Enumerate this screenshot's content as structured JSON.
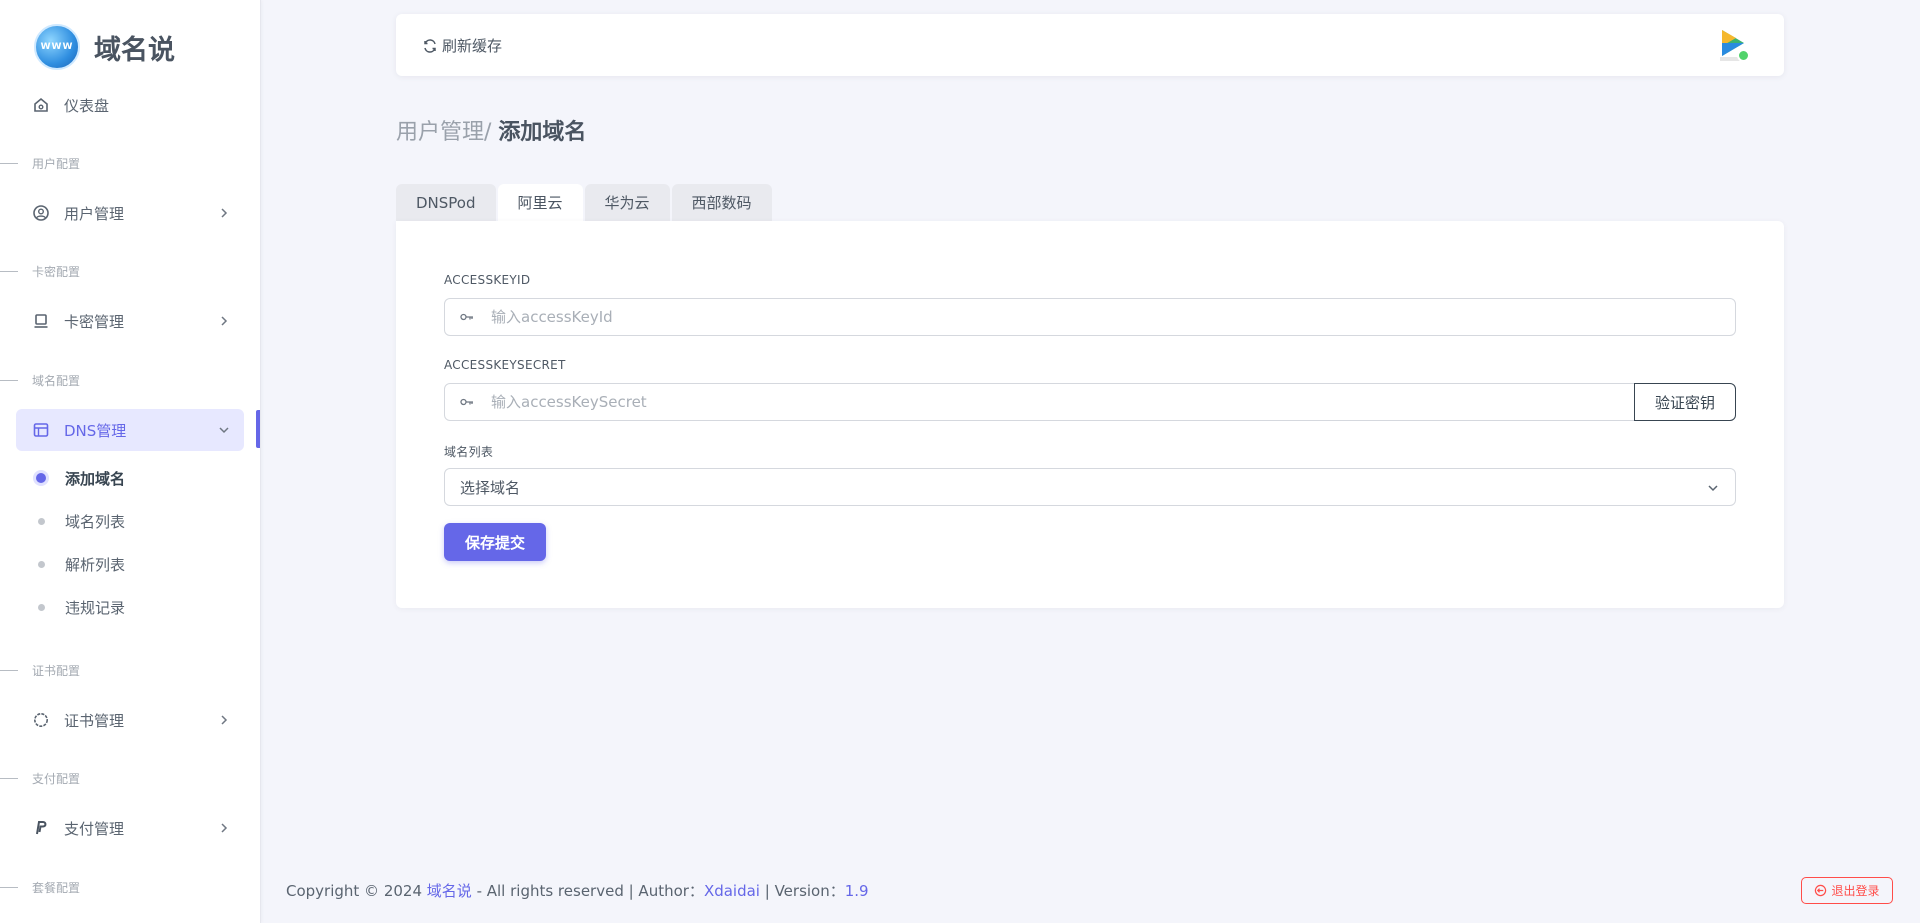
{
  "brand": {
    "name": "域名说",
    "logo_text": "WWW"
  },
  "sidebar": {
    "dashboard": "仪表盘",
    "sections": {
      "user": "用户配置",
      "card": "卡密配置",
      "domain": "域名配置",
      "cert": "证书配置",
      "pay": "支付配置",
      "package": "套餐配置"
    },
    "items": {
      "user_mgmt": "用户管理",
      "card_mgmt": "卡密管理",
      "dns_mgmt": "DNS管理",
      "cert_mgmt": "证书管理",
      "pay_mgmt": "支付管理"
    },
    "dns_sub": [
      "添加域名",
      "域名列表",
      "解析列表",
      "违规记录"
    ]
  },
  "navbar": {
    "refresh": "刷新缓存"
  },
  "page": {
    "crumb": "用户管理/",
    "title": "添加域名"
  },
  "tabs": [
    "DNSPod",
    "阿里云",
    "华为云",
    "西部数码"
  ],
  "form": {
    "access_key_id_label": "ACCESSKEYID",
    "access_key_id_placeholder": "输入accessKeyId",
    "access_key_secret_label": "ACCESSKEYSECRET",
    "access_key_secret_placeholder": "输入accessKeySecret",
    "verify_button": "验证密钥",
    "domain_list_label": "域名列表",
    "domain_select_value": "选择域名",
    "submit_button": "保存提交"
  },
  "footer": {
    "prefix": "Copyright © 2024 ",
    "brand": "域名说",
    "middle": " - All rights reserved | Author：",
    "author": "Xdaidai",
    "version_prefix": " | Version：",
    "version": "1.9",
    "logout": "退出登录"
  },
  "colors": {
    "accent": "#6567e8",
    "danger": "#ff4d49",
    "background": "#f4f5fb"
  }
}
